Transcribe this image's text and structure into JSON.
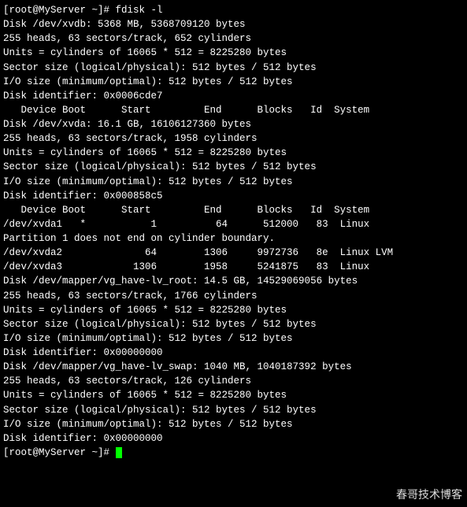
{
  "prompt1": "[root@MyServer ~]# ",
  "cmd1": "fdisk -l",
  "blank": "",
  "xvdb": {
    "l1": "Disk /dev/xvdb: 5368 MB, 5368709120 bytes",
    "l2": "255 heads, 63 sectors/track, 652 cylinders",
    "l3": "Units = cylinders of 16065 * 512 = 8225280 bytes",
    "l4": "Sector size (logical/physical): 512 bytes / 512 bytes",
    "l5": "I/O size (minimum/optimal): 512 bytes / 512 bytes",
    "l6": "Disk identifier: 0x0006cde7",
    "hdr": "   Device Boot      Start         End      Blocks   Id  System"
  },
  "xvda": {
    "l1": "Disk /dev/xvda: 16.1 GB, 16106127360 bytes",
    "l2": "255 heads, 63 sectors/track, 1958 cylinders",
    "l3": "Units = cylinders of 16065 * 512 = 8225280 bytes",
    "l4": "Sector size (logical/physical): 512 bytes / 512 bytes",
    "l5": "I/O size (minimum/optimal): 512 bytes / 512 bytes",
    "l6": "Disk identifier: 0x000858c5",
    "hdr": "   Device Boot      Start         End      Blocks   Id  System",
    "p1": "/dev/xvda1   *           1          64      512000   83  Linux",
    "pw": "Partition 1 does not end on cylinder boundary.",
    "p2": "/dev/xvda2              64        1306     9972736   8e  Linux LVM",
    "p3": "/dev/xvda3            1306        1958     5241875   83  Linux"
  },
  "lvroot": {
    "l1": "Disk /dev/mapper/vg_have-lv_root: 14.5 GB, 14529069056 bytes",
    "l2": "255 heads, 63 sectors/track, 1766 cylinders",
    "l3": "Units = cylinders of 16065 * 512 = 8225280 bytes",
    "l4": "Sector size (logical/physical): 512 bytes / 512 bytes",
    "l5": "I/O size (minimum/optimal): 512 bytes / 512 bytes",
    "l6": "Disk identifier: 0x00000000"
  },
  "lvswap": {
    "l1": "Disk /dev/mapper/vg_have-lv_swap: 1040 MB, 1040187392 bytes",
    "l2": "255 heads, 63 sectors/track, 126 cylinders",
    "l3": "Units = cylinders of 16065 * 512 = 8225280 bytes",
    "l4": "Sector size (logical/physical): 512 bytes / 512 bytes",
    "l5": "I/O size (minimum/optimal): 512 bytes / 512 bytes",
    "l6": "Disk identifier: 0x00000000"
  },
  "prompt2": "[root@MyServer ~]# ",
  "watermark": "春哥技术博客"
}
